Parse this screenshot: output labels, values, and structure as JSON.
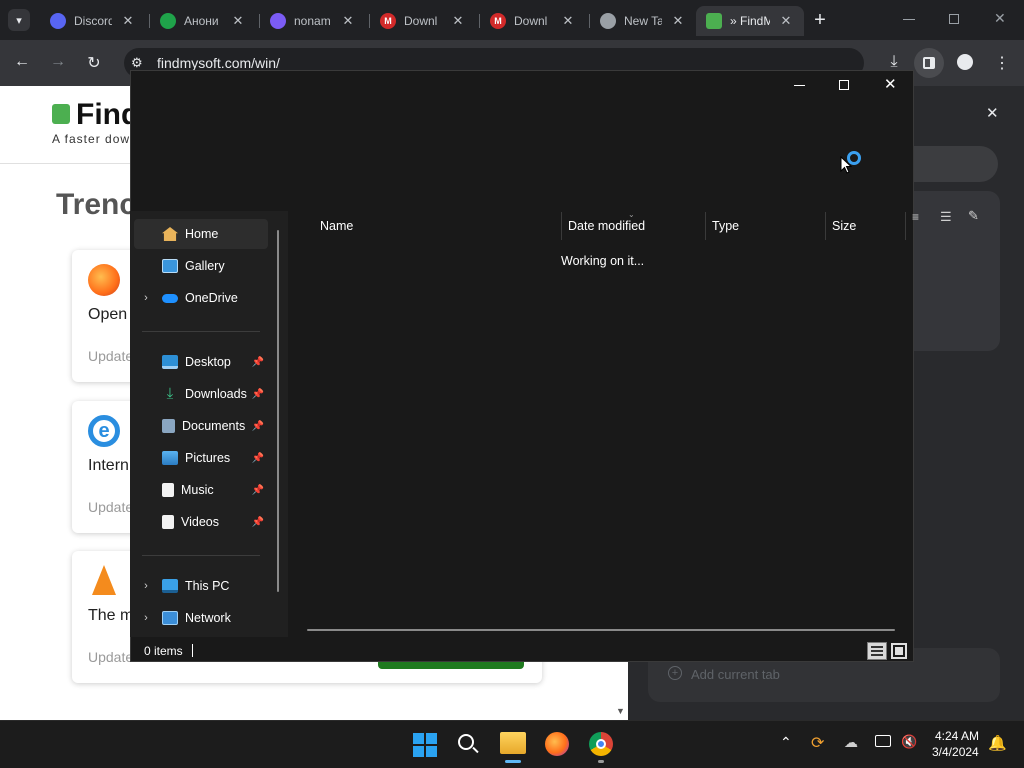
{
  "browser": {
    "tabs": [
      {
        "label": "Discord",
        "color": "#5865f2"
      },
      {
        "label": "Анони",
        "color": "#1fa34a"
      },
      {
        "label": "nonam",
        "color": "#7b5cf5"
      },
      {
        "label": "Downl",
        "color": "#d22a2a"
      },
      {
        "label": "Downl",
        "color": "#d22a2a"
      },
      {
        "label": "New Ta",
        "color": "#9aa0a6"
      },
      {
        "label": "» FindM",
        "color": "#4caf50"
      }
    ],
    "new_tab_symbol": "+",
    "url": "findmysoft.com/win/"
  },
  "webpage": {
    "logo_text": "Find",
    "tagline": "A faster dow",
    "heading": "Trenc",
    "cards": [
      {
        "title": "Open",
        "updated": "Update",
        "icon": "firefox-icon"
      },
      {
        "title": "Intern",
        "updated": "Update",
        "icon": "internet-explorer-icon"
      },
      {
        "title": "The m",
        "updated": "Update",
        "icon": "vlc-icon"
      }
    ]
  },
  "side_panel": {
    "close_symbol": "✕",
    "add_current_tab": "Add current tab"
  },
  "dialog": {
    "nav": {
      "home": "Home",
      "gallery": "Gallery",
      "onedrive": "OneDrive",
      "desktop": "Desktop",
      "downloads": "Downloads",
      "documents": "Documents",
      "pictures": "Pictures",
      "music": "Music",
      "videos": "Videos",
      "thispc": "This PC",
      "network": "Network"
    },
    "columns": {
      "name": "Name",
      "date": "Date modified",
      "type": "Type",
      "size": "Size"
    },
    "status": "Working on it...",
    "items_count": "0 items"
  },
  "taskbar": {
    "time": "4:24 AM",
    "date": "3/4/2024"
  },
  "colors": {
    "accent": "#0078d4",
    "dialog_bg": "#191919",
    "nav_bg": "#202020"
  }
}
